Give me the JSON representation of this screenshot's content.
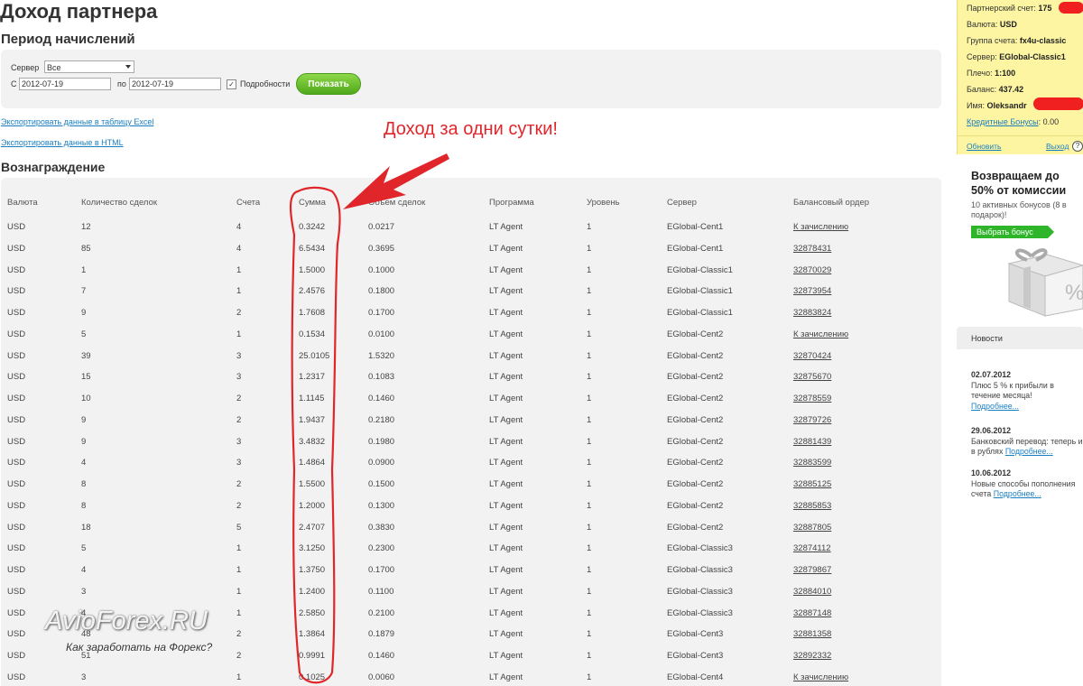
{
  "page": {
    "title": "Доход партнера"
  },
  "period": {
    "title": "Период начислений",
    "server_label": "Сервер",
    "server_value": "Все",
    "from_label": "С",
    "from_value": "2012-07-19",
    "to_label": "по",
    "to_value": "2012-07-19",
    "details_label": "Подробности",
    "details_checked": true,
    "show_button": "Показать"
  },
  "exports": {
    "excel": "Экспортировать данные в таблицу Excel",
    "html": "Экспортировать данные в HTML"
  },
  "annotation": "Доход за одни сутки!",
  "reward": {
    "title": "Вознаграждение",
    "columns": [
      "Валюта",
      "Количество сделок",
      "Счета",
      "Сумма",
      "Объем сделок",
      "Программа",
      "Уровень",
      "Сервер",
      "Балансовый ордер"
    ],
    "rows": [
      [
        "USD",
        "12",
        "4",
        "0.3242",
        "0.0217",
        "LT Agent",
        "1",
        "EGlobal-Cent1",
        "К зачислению"
      ],
      [
        "USD",
        "85",
        "4",
        "6.5434",
        "0.3695",
        "LT Agent",
        "1",
        "EGlobal-Cent1",
        "32878431"
      ],
      [
        "USD",
        "1",
        "1",
        "1.5000",
        "0.1000",
        "LT Agent",
        "1",
        "EGlobal-Classic1",
        "32870029"
      ],
      [
        "USD",
        "7",
        "1",
        "2.4576",
        "0.1800",
        "LT Agent",
        "1",
        "EGlobal-Classic1",
        "32873954"
      ],
      [
        "USD",
        "9",
        "2",
        "1.7608",
        "0.1700",
        "LT Agent",
        "1",
        "EGlobal-Classic1",
        "32883824"
      ],
      [
        "USD",
        "5",
        "1",
        "0.1534",
        "0.0100",
        "LT Agent",
        "1",
        "EGlobal-Cent2",
        "К зачислению"
      ],
      [
        "USD",
        "39",
        "3",
        "25.0105",
        "1.5320",
        "LT Agent",
        "1",
        "EGlobal-Cent2",
        "32870424"
      ],
      [
        "USD",
        "15",
        "3",
        "1.2317",
        "0.1083",
        "LT Agent",
        "1",
        "EGlobal-Cent2",
        "32875670"
      ],
      [
        "USD",
        "10",
        "2",
        "1.1145",
        "0.1460",
        "LT Agent",
        "1",
        "EGlobal-Cent2",
        "32878559"
      ],
      [
        "USD",
        "9",
        "2",
        "1.9437",
        "0.2180",
        "LT Agent",
        "1",
        "EGlobal-Cent2",
        "32879726"
      ],
      [
        "USD",
        "9",
        "3",
        "3.4832",
        "0.1980",
        "LT Agent",
        "1",
        "EGlobal-Cent2",
        "32881439"
      ],
      [
        "USD",
        "4",
        "3",
        "1.4864",
        "0.0900",
        "LT Agent",
        "1",
        "EGlobal-Cent2",
        "32883599"
      ],
      [
        "USD",
        "8",
        "2",
        "1.5500",
        "0.1500",
        "LT Agent",
        "1",
        "EGlobal-Cent2",
        "32885125"
      ],
      [
        "USD",
        "8",
        "2",
        "1.2000",
        "0.1300",
        "LT Agent",
        "1",
        "EGlobal-Cent2",
        "32885853"
      ],
      [
        "USD",
        "18",
        "5",
        "2.4707",
        "0.3830",
        "LT Agent",
        "1",
        "EGlobal-Cent2",
        "32887805"
      ],
      [
        "USD",
        "5",
        "1",
        "3.1250",
        "0.2300",
        "LT Agent",
        "1",
        "EGlobal-Classic3",
        "32874112"
      ],
      [
        "USD",
        "4",
        "1",
        "1.3750",
        "0.1700",
        "LT Agent",
        "1",
        "EGlobal-Classic3",
        "32879867"
      ],
      [
        "USD",
        "3",
        "1",
        "1.2400",
        "0.1100",
        "LT Agent",
        "1",
        "EGlobal-Classic3",
        "32884010"
      ],
      [
        "USD",
        "4",
        "1",
        "2.5850",
        "0.2100",
        "LT Agent",
        "1",
        "EGlobal-Classic3",
        "32887148"
      ],
      [
        "USD",
        "48",
        "2",
        "1.3864",
        "0.1879",
        "LT Agent",
        "1",
        "EGlobal-Cent3",
        "32881358"
      ],
      [
        "USD",
        "51",
        "2",
        "0.9991",
        "0.1460",
        "LT Agent",
        "1",
        "EGlobal-Cent3",
        "32892332"
      ],
      [
        "USD",
        "3",
        "1",
        "0.1025",
        "0.0060",
        "LT Agent",
        "1",
        "EGlobal-Cent4",
        "К зачислению"
      ]
    ]
  },
  "watermark": {
    "main": "AvioForex.RU",
    "sub": "Как заработать на Форекс?"
  },
  "account": {
    "partner_account_label": "Партнерский счет:",
    "partner_account_value": "175",
    "currency_label": "Валюта:",
    "currency_value": "USD",
    "group_label": "Группа счета:",
    "group_value": "fx4u-classic",
    "server_label": "Сервер:",
    "server_value": "EGlobal-Classic1",
    "leverage_label": "Плечо:",
    "leverage_value": "1:100",
    "balance_label": "Баланс:",
    "balance_value": "437.42",
    "name_label": "Имя:",
    "name_value": "Oleksandr",
    "credit_bonus_label": "Кредитные Бонусы",
    "credit_bonus_value": ": 0.00",
    "refresh_link": "Обновить",
    "logout_link": "Выход",
    "help_icon": "?"
  },
  "promo": {
    "title": "Возвращаем до 50% от комиссии",
    "subtitle": "10 активных бонусов (8 в подарок)!",
    "button": "Выбрать бонус",
    "gift_badge": "%"
  },
  "news": {
    "title": "Новости",
    "items": [
      {
        "date": "02.07.2012",
        "text": "Плюс 5 % к прибыли в течение месяца!",
        "more": "Подробнее..."
      },
      {
        "date": "29.06.2012",
        "text": "Банковский перевод: теперь и в рублях",
        "more": "Подробнее..."
      },
      {
        "date": "10.06.2012",
        "text": "Новые способы пополнения счета",
        "more": "Подробнее..."
      }
    ]
  },
  "colors": {
    "accent_green": "#4fa81a",
    "link_blue": "#1a7fc1",
    "annotation_red": "#e0262b",
    "account_panel_bg": "#fdf5a2"
  }
}
